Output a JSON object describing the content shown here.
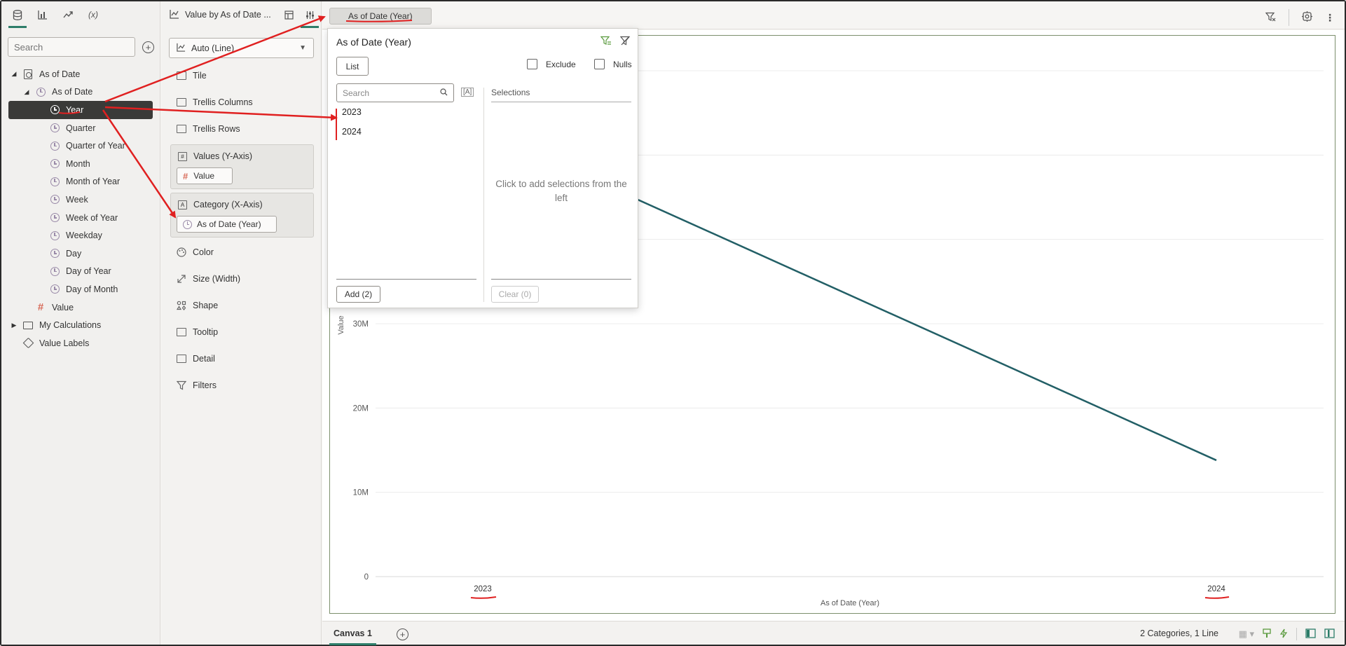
{
  "data_panel": {
    "tabs": [
      "database-icon",
      "bar-chart-icon",
      "trend-icon",
      "(x)"
    ],
    "search_placeholder": "Search",
    "tree": [
      {
        "label": "As of Date",
        "level": 0,
        "expanded": true,
        "icon": "dataset-icon"
      },
      {
        "label": "As of Date",
        "level": 1,
        "expanded": true,
        "icon": "clock-icon"
      },
      {
        "label": "Year",
        "level": 2,
        "icon": "clock-icon",
        "selected": true
      },
      {
        "label": "Quarter",
        "level": 2,
        "icon": "clock-icon"
      },
      {
        "label": "Quarter of Year",
        "level": 2,
        "icon": "clock-icon"
      },
      {
        "label": "Month",
        "level": 2,
        "icon": "clock-icon"
      },
      {
        "label": "Month of Year",
        "level": 2,
        "icon": "clock-icon"
      },
      {
        "label": "Week",
        "level": 2,
        "icon": "clock-icon"
      },
      {
        "label": "Week of Year",
        "level": 2,
        "icon": "clock-icon"
      },
      {
        "label": "Weekday",
        "level": 2,
        "icon": "clock-icon"
      },
      {
        "label": "Day",
        "level": 2,
        "icon": "clock-icon"
      },
      {
        "label": "Day of Year",
        "level": 2,
        "icon": "clock-icon"
      },
      {
        "label": "Day of Month",
        "level": 2,
        "icon": "clock-icon"
      },
      {
        "label": "Value",
        "level": 1,
        "icon": "hash-icon"
      },
      {
        "label": "My Calculations",
        "level": 0,
        "collapsed": true,
        "icon": "folder-icon"
      },
      {
        "label": "Value Labels",
        "level": 0,
        "icon": "tag-icon"
      }
    ]
  },
  "grammar": {
    "title": "Value by As of Date ...",
    "viz_type": "Auto (Line)",
    "tile": "Tile",
    "trellis_columns": "Trellis Columns",
    "trellis_rows": "Trellis Rows",
    "values_label": "Values (Y-Axis)",
    "values_chip": "Value",
    "category_label": "Category (X-Axis)",
    "category_chip": "As of Date (Year)",
    "color": "Color",
    "size": "Size (Width)",
    "shape": "Shape",
    "tooltip": "Tooltip",
    "detail": "Detail",
    "filters": "Filters"
  },
  "canvas": {
    "filter_pill": "As of Date (Year)",
    "tab": "Canvas 1",
    "status": "2 Categories, 1 Line"
  },
  "popup": {
    "title": "As of Date (Year)",
    "list_button": "List",
    "exclude_label": "Exclude",
    "nulls_label": "Nulls",
    "search_placeholder": "Search",
    "sort_icon": "[A]",
    "selections_header": "Selections",
    "items": [
      "2023",
      "2024"
    ],
    "empty_text": "Click to add selections from the left",
    "add_button": "Add (2)",
    "clear_button": "Clear (0)"
  },
  "chart_data": {
    "type": "line",
    "categories": [
      "2023",
      "2024"
    ],
    "series": [
      {
        "values": [
          53000000,
          13800000
        ]
      }
    ],
    "xlabel": "As of Date (Year)",
    "ylabel": "Value",
    "yticks": [
      "0",
      "10M",
      "20M",
      "30M"
    ],
    "ylim": [
      0,
      60000000
    ],
    "grid": true,
    "line_color": "#225f66"
  }
}
